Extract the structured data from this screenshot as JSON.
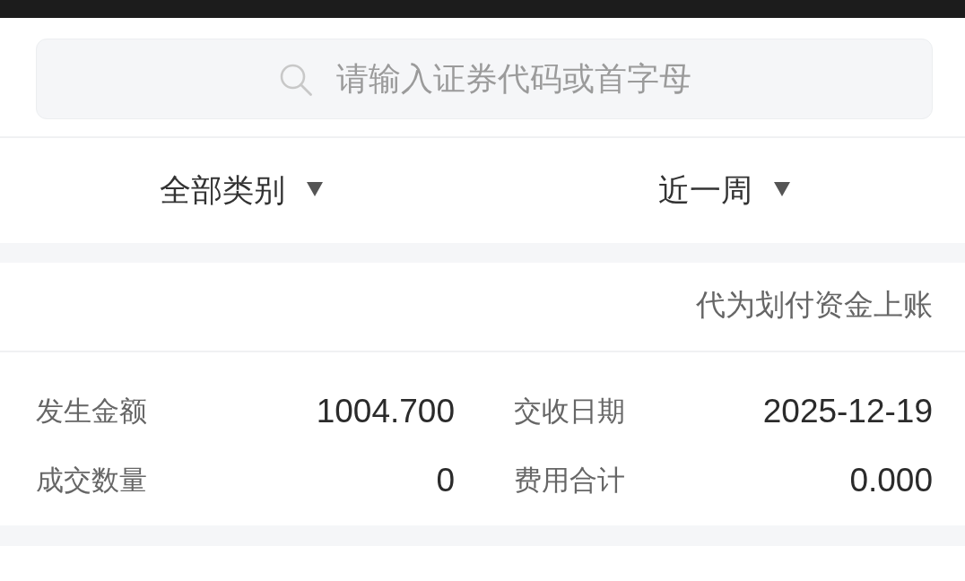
{
  "search": {
    "placeholder": "请输入证券代码或首字母"
  },
  "filters": [
    {
      "label": "全部类别"
    },
    {
      "label": "近一周"
    }
  ],
  "record": {
    "type": "代为划付资金上账",
    "fields": [
      {
        "label": "发生金额",
        "value": "1004.700"
      },
      {
        "label": "交收日期",
        "value": "2025-12-19"
      },
      {
        "label": "成交数量",
        "value": "0"
      },
      {
        "label": "费用合计",
        "value": "0.000"
      }
    ]
  }
}
